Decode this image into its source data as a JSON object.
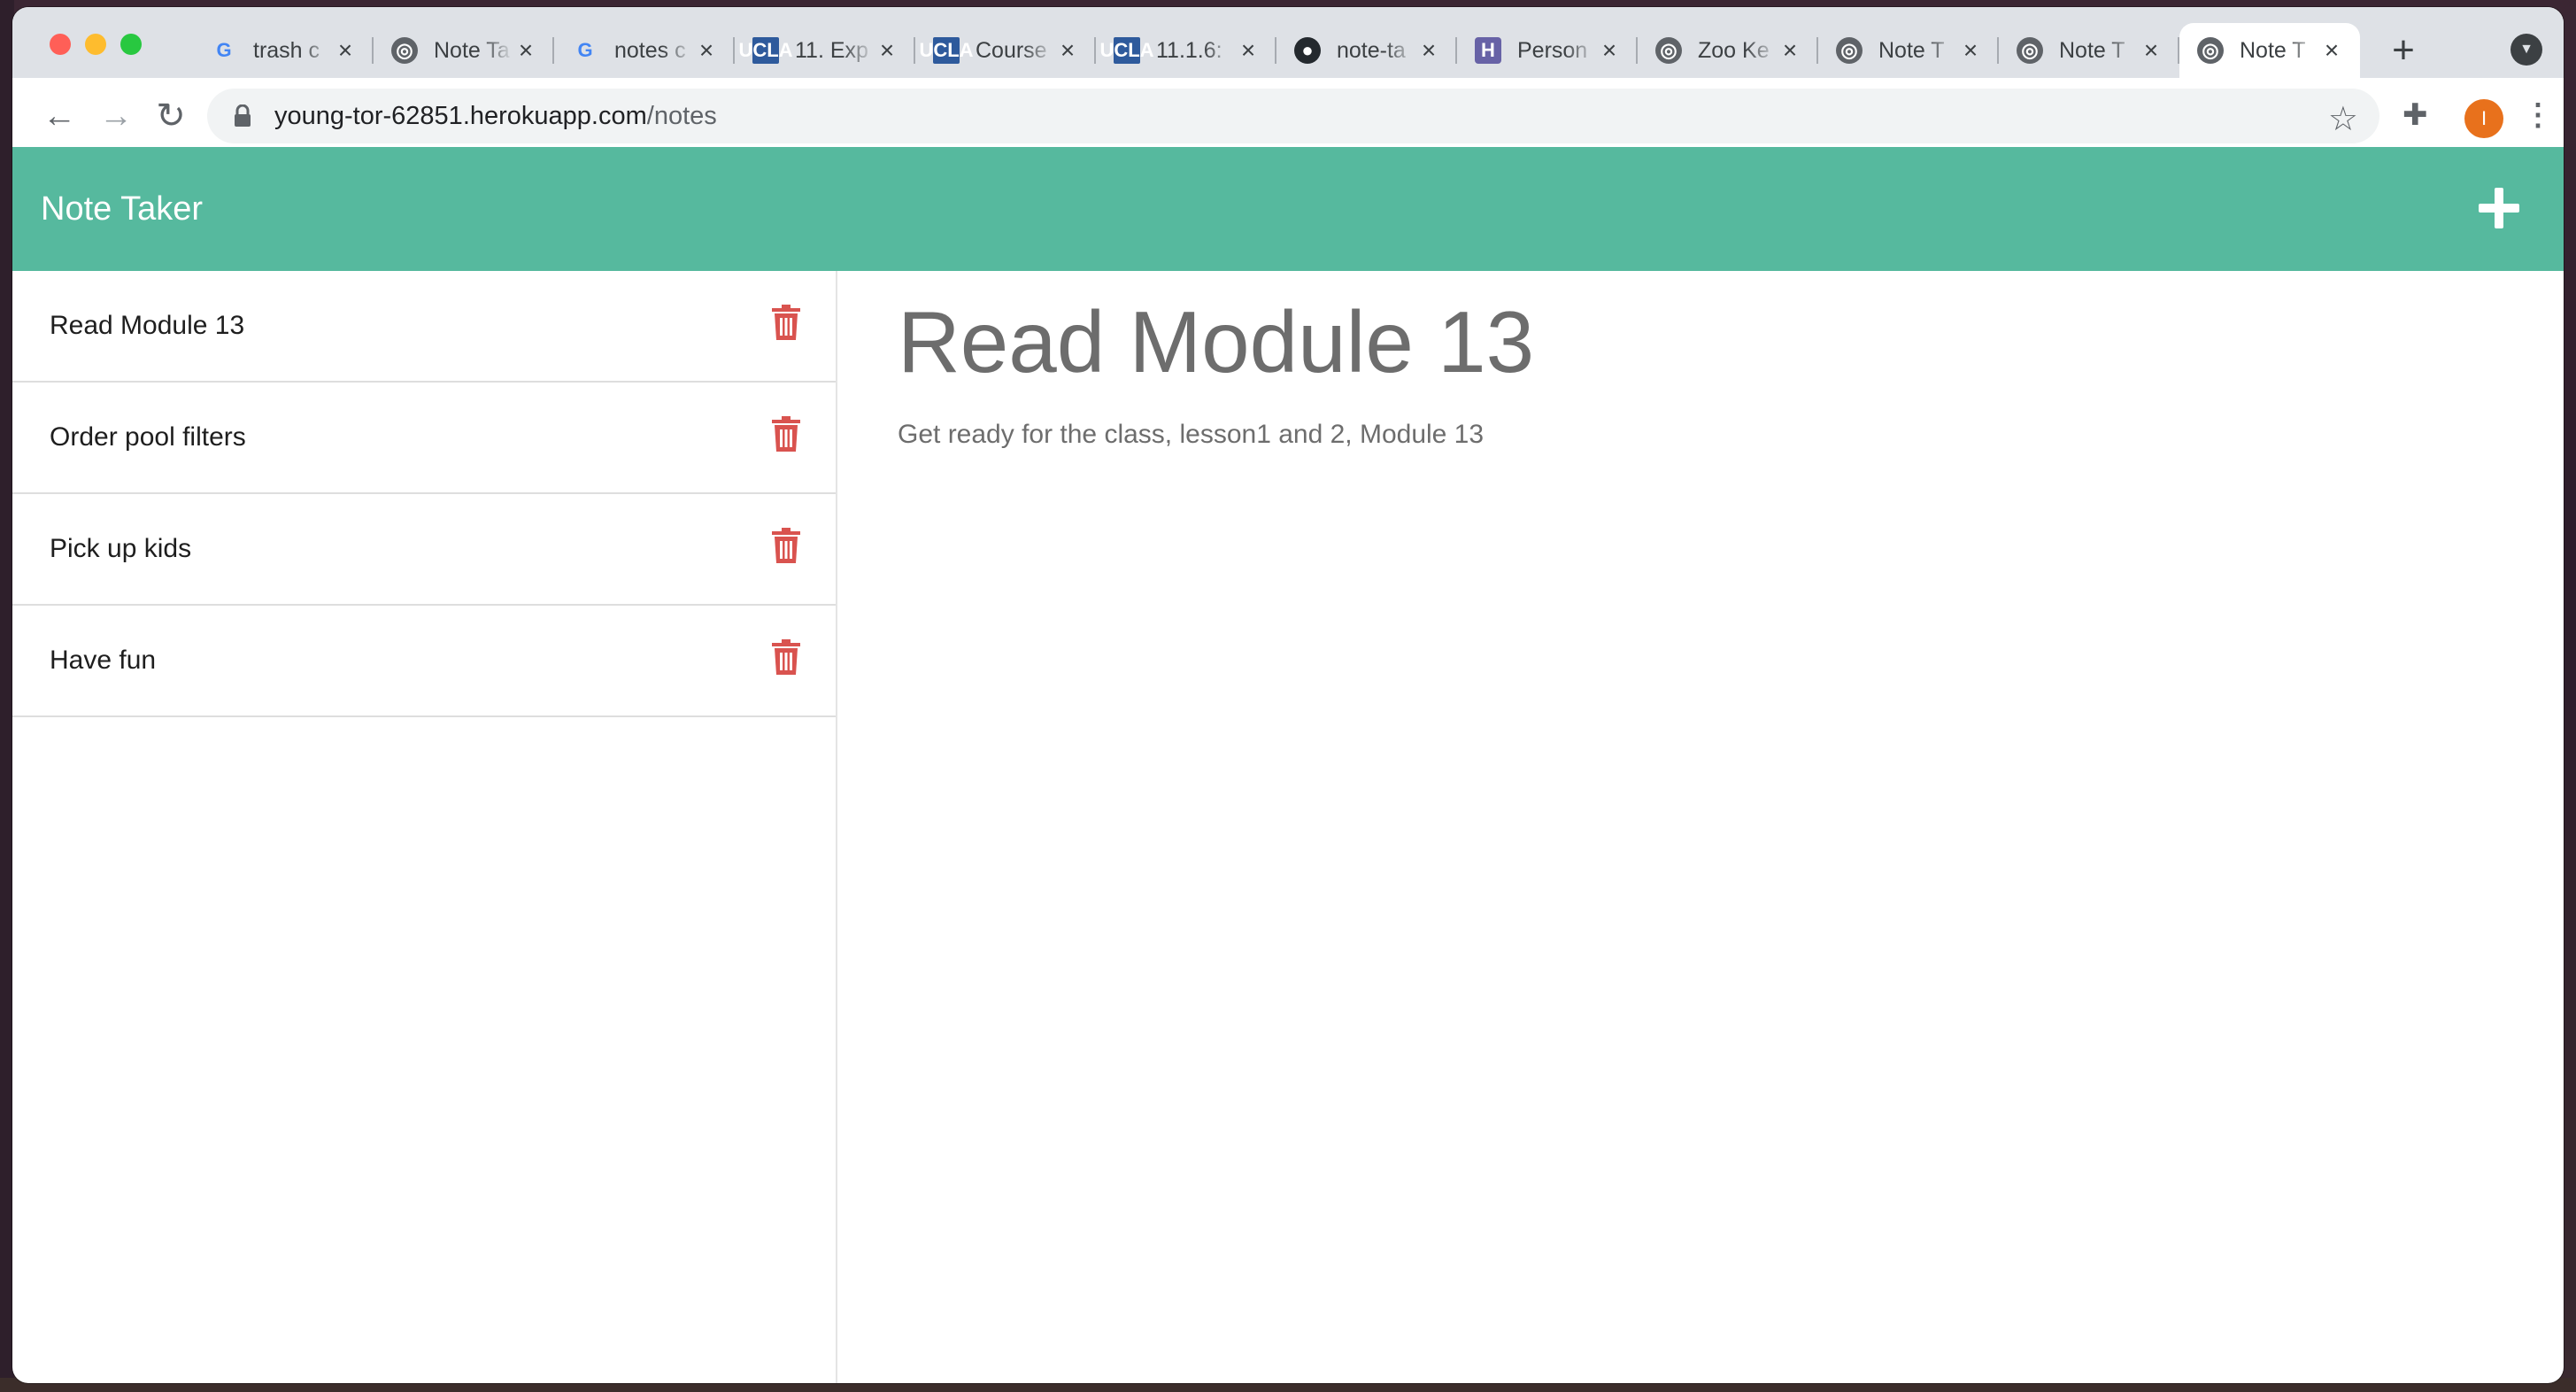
{
  "browser": {
    "tabs": [
      {
        "title": "trash c",
        "favicon": "google-icon"
      },
      {
        "title": "Note Ta",
        "favicon": "globe-icon"
      },
      {
        "title": "notes c",
        "favicon": "google-icon"
      },
      {
        "title": "11. Exp",
        "favicon": "ucla-icon"
      },
      {
        "title": "Course",
        "favicon": "ucla-icon"
      },
      {
        "title": "11.1.6:",
        "favicon": "ucla-icon"
      },
      {
        "title": "note-ta",
        "favicon": "github-icon"
      },
      {
        "title": "Person",
        "favicon": "heroku-icon"
      },
      {
        "title": "Zoo Ke",
        "favicon": "globe-icon"
      },
      {
        "title": "Note T",
        "favicon": "globe-icon"
      },
      {
        "title": "Note T",
        "favicon": "globe-icon"
      },
      {
        "title": "Note T",
        "favicon": "globe-icon",
        "active": true
      }
    ],
    "url_host": "young-tor-62851.herokuapp.com",
    "url_path": "/notes",
    "avatar_initial": "I",
    "colors": {
      "tabstrip": "#dee1e6",
      "avatar": "#e8711c"
    }
  },
  "app": {
    "title": "Note Taker",
    "header_color": "#56b99e",
    "delete_color": "#d9534f",
    "notes": [
      {
        "title": "Read Module 13"
      },
      {
        "title": "Order pool filters"
      },
      {
        "title": "Pick up kids"
      },
      {
        "title": "Have fun"
      }
    ],
    "active_note": {
      "title": "Read Module 13",
      "text": "Get ready for the class, lesson1 and 2, Module 13"
    }
  }
}
